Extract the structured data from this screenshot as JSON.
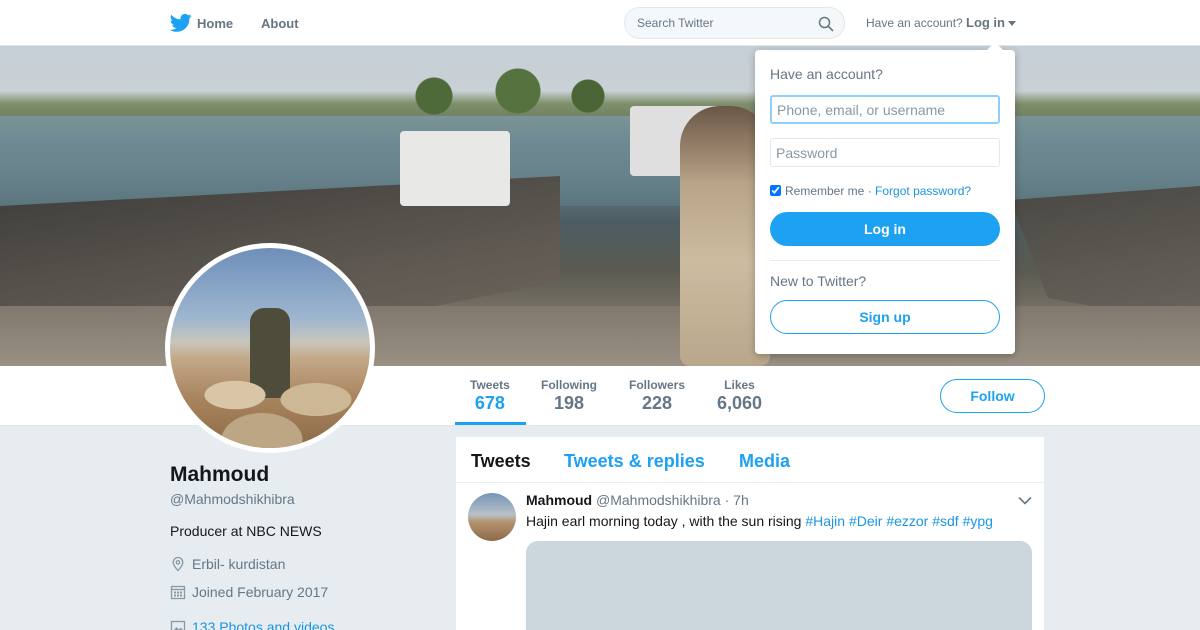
{
  "nav": {
    "logo_icon": "twitter-bird-icon",
    "home_label": "Home",
    "about_label": "About",
    "search_placeholder": "Search Twitter",
    "have_account_text": "Have an account?",
    "login_label": "Log in"
  },
  "profile": {
    "name": "Mahmoud",
    "handle": "@Mahmodshikhibra",
    "bio": "Producer at NBC NEWS",
    "location": "Erbil- kurdistan",
    "joined": "Joined February 2017",
    "photos_link": "133 Photos and videos",
    "follow_label": "Follow"
  },
  "stats": [
    {
      "label": "Tweets",
      "value": "678",
      "active": true
    },
    {
      "label": "Following",
      "value": "198",
      "active": false
    },
    {
      "label": "Followers",
      "value": "228",
      "active": false
    },
    {
      "label": "Likes",
      "value": "6,060",
      "active": false
    }
  ],
  "timeline": {
    "tabs": [
      "Tweets",
      "Tweets & replies",
      "Media"
    ],
    "active_tab": "Tweets",
    "tweet": {
      "author_name": "Mahmoud",
      "author_handle": "@Mahmodshikhibra",
      "separator": "·",
      "time": "7h",
      "text": "Hajin earl morning today , with the sun rising",
      "hashtags": [
        "#Hajin",
        "#Deir",
        "#ezzor",
        "#sdf",
        "#ypg"
      ]
    }
  },
  "login_popup": {
    "title": "Have an account?",
    "username_placeholder": "Phone, email, or username",
    "password_placeholder": "Password",
    "remember_label": "Remember me",
    "separator": "·",
    "forgot_label": "Forgot password?",
    "login_button": "Log in",
    "new_text": "New to Twitter?",
    "signup_button": "Sign up"
  },
  "colors": {
    "accent": "#1da1f2",
    "link": "#1b95e0",
    "page_bg": "#e6ecf0",
    "muted": "#657786"
  }
}
